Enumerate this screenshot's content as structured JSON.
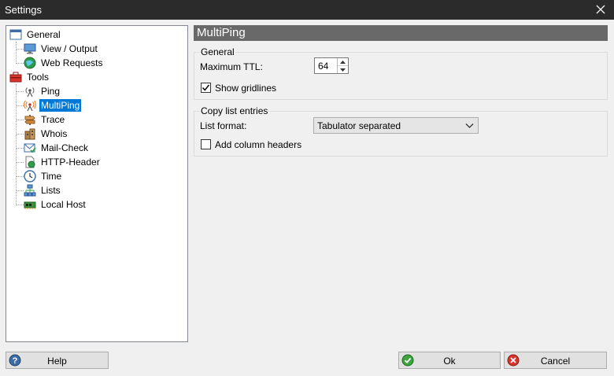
{
  "window": {
    "title": "Settings"
  },
  "tree": {
    "general": "General",
    "view_output": "View / Output",
    "web_requests": "Web Requests",
    "tools": "Tools",
    "ping": "Ping",
    "multiping": "MultiPing",
    "trace": "Trace",
    "whois": "Whois",
    "mail_check": "Mail-Check",
    "http_header": "HTTP-Header",
    "time": "Time",
    "lists": "Lists",
    "local_host": "Local Host"
  },
  "panel": {
    "title": "MultiPing",
    "general_group": {
      "caption": "General",
      "ttl_label": "Maximum TTL:",
      "ttl_value": "64",
      "gridlines_label": "Show gridlines",
      "gridlines_checked": true
    },
    "copy_group": {
      "caption": "Copy list entries",
      "format_label": "List format:",
      "format_value": "Tabulator separated",
      "headers_label": "Add column headers",
      "headers_checked": false
    }
  },
  "buttons": {
    "help": "Help",
    "ok": "Ok",
    "cancel": "Cancel"
  }
}
